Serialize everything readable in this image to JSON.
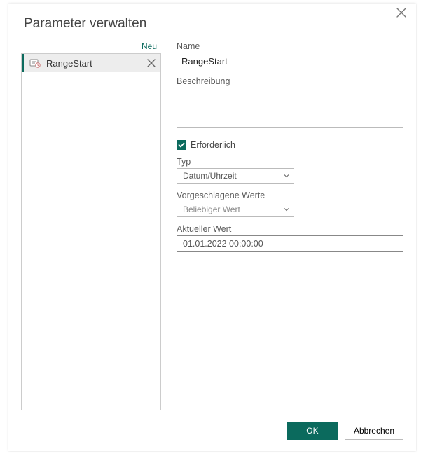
{
  "dialog": {
    "title": "Parameter verwalten",
    "new_link": "Neu"
  },
  "param_list": {
    "items": [
      {
        "label": "RangeStart"
      }
    ]
  },
  "form": {
    "name_label": "Name",
    "name_value": "RangeStart",
    "desc_label": "Beschreibung",
    "desc_value": "",
    "required_checked": true,
    "required_label": "Erforderlich",
    "type_label": "Typ",
    "type_value": "Datum/Uhrzeit",
    "suggested_label": "Vorgeschlagene Werte",
    "suggested_value": "Beliebiger Wert",
    "current_label": "Aktueller Wert",
    "current_value": "01.01.2022 00:00:00"
  },
  "footer": {
    "ok": "OK",
    "cancel": "Abbrechen"
  }
}
